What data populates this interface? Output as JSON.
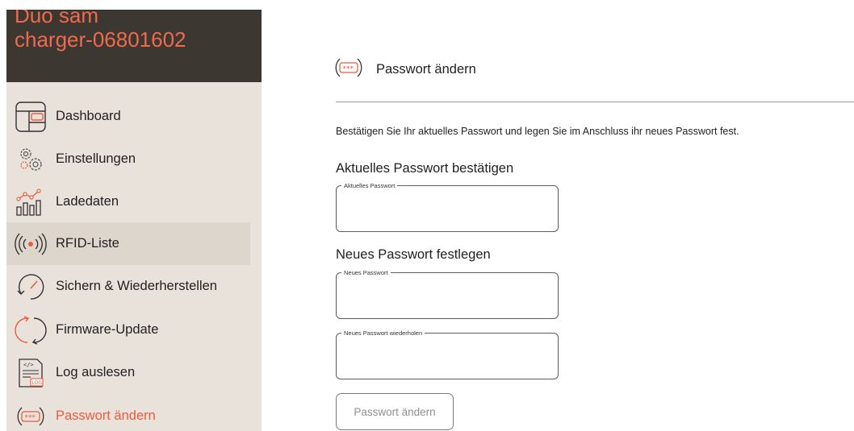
{
  "brand": {
    "line1": "Duo sam",
    "line2": "charger-06801602"
  },
  "sidebar": {
    "items": [
      {
        "label": "Dashboard",
        "icon": "dashboard-icon"
      },
      {
        "label": "Einstellungen",
        "icon": "gears-icon"
      },
      {
        "label": "Ladedaten",
        "icon": "chart-icon"
      },
      {
        "label": "RFID-Liste",
        "icon": "rfid-icon"
      },
      {
        "label": "Sichern & Wiederherstellen",
        "icon": "backup-icon"
      },
      {
        "label": "Firmware-Update",
        "icon": "update-icon"
      },
      {
        "label": "Log auslesen",
        "icon": "log-icon"
      },
      {
        "label": "Passwort ändern",
        "icon": "password-icon"
      }
    ]
  },
  "main": {
    "title": "Passwort ändern",
    "intro": "Bestätigen Sie Ihr aktuelles Passwort und legen Sie im Anschluss ihr neues Passwort fest.",
    "section_current": "Aktuelles Passwort bestätigen",
    "field_current_label": "Aktuelles Passwort",
    "section_new": "Neues Passwort festlegen",
    "field_new_label": "Neues Passwort",
    "field_repeat_label": "Neues Passwort wiederholen",
    "submit_label": "Passwort ändern"
  },
  "colors": {
    "accent": "#ee5a3e",
    "brand_bg": "#3d3732",
    "sidebar_bg": "#e8e2da"
  }
}
